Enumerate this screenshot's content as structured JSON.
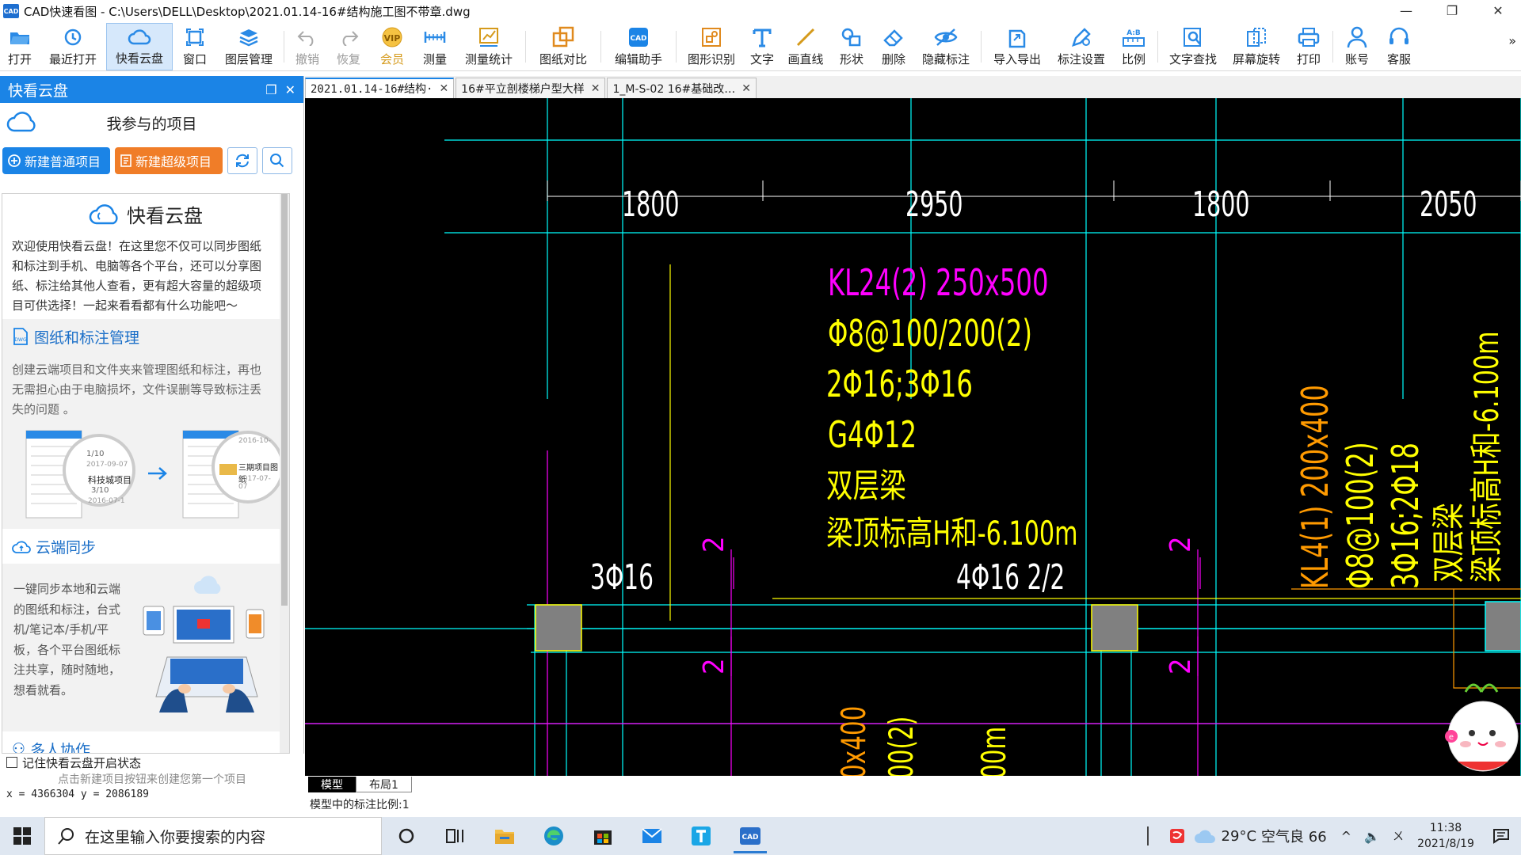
{
  "window": {
    "logo": "CAD",
    "title": "CAD快速看图 - C:\\Users\\DELL\\Desktop\\2021.01.14-16#结构施工图不带章.dwg",
    "minimize": "—",
    "maximize": "❐",
    "close": "✕"
  },
  "toolbar": {
    "open": "打开",
    "recent": "最近打开",
    "cloud": "快看云盘",
    "window": "窗口",
    "layers": "图层管理",
    "undo": "撤销",
    "redo": "恢复",
    "vip": "会员",
    "measure": "测量",
    "measure_stats": "测量统计",
    "compare": "图纸对比",
    "edit_helper": "编辑助手",
    "shape_recog": "图形识别",
    "text": "文字",
    "line": "画直线",
    "shape": "形状",
    "delete": "删除",
    "hide_annot": "隐藏标注",
    "import_export": "导入导出",
    "annot_settings": "标注设置",
    "scale": "比例",
    "text_search": "文字查找",
    "rotate": "屏幕旋转",
    "print": "打印",
    "account": "账号",
    "service": "客服",
    "more": "»"
  },
  "leftpanel": {
    "header": "快看云盘",
    "my_projects": "我参与的项目",
    "new_normal": "新建普通项目",
    "new_super": "新建超级项目",
    "intro_title": "快看云盘",
    "intro_text": "欢迎使用快看云盘！在这里您不仅可以同步图纸和标注到手机、电脑等各个平台，还可以分享图纸、标注给其他人查看，更有超大容量的超级项目可供选择！一起来看看都有什么功能吧～",
    "sec1_title": "图纸和标注管理",
    "sec1_text": "创建云端项目和文件夹来管理图纸和标注，再也无需担心由于电脑损坏，文件误删等导致标注丢失的问题 。",
    "sec1_img_a_label": "科技城项目",
    "sec1_img_a_count": "3/10",
    "sec1_img_a_date": "2016-07-1",
    "sec1_img_a_count2": "1/10",
    "sec1_img_a_date2": "2017-09-07",
    "sec1_img_b_label": "三期项目图纸",
    "sec1_img_b_date": "2017-07-07",
    "sec1_img_b_date2": "2016-10-",
    "sec2_title": "云端同步",
    "sec2_text": "一键同步本地和云端的图纸和标注，台式机/笔记本/手机/平板，各个平台图纸标注共享，随时随地，想看就看。",
    "sec3_title": "多人协作",
    "remember": "记住快看云盘开启状态",
    "hint": "点击新建项目按钮来创建您第一个项目",
    "coords": "x = 4366304 y = 2086189"
  },
  "tabs": [
    {
      "label": "2021.01.14-16#结构·",
      "close": "✕"
    },
    {
      "label": "16#平立剖楼梯户型大样",
      "close": "✕"
    },
    {
      "label": "1_M-S-02 16#基础改…",
      "close": "✕"
    }
  ],
  "cad": {
    "dim1": "1800",
    "dim2": "2950",
    "dim3": "1800",
    "dim4": "2050",
    "beam_label": "KL24(2) 250x500",
    "stirrup": "Φ8@100/200(2)",
    "bars": "2Φ16;3Φ16",
    "side_bars": "G4Φ12",
    "double_beam": "双层梁",
    "top_elev": "梁顶标高H和-6.100m",
    "rebar_left": "3Φ16",
    "rebar_mid": "4Φ16 2/2",
    "vert_kl4": "KL4(1) 200x400",
    "vert_stirrup": "Φ8@100(2)",
    "vert_bars": "3Φ16;2Φ18",
    "vert_double": "双层梁",
    "vert_elev": "梁顶标高H和-6.100m",
    "mark2": "2",
    "bottom_a": "0x400",
    "bottom_b": "00(2)",
    "bottom_c": "00m"
  },
  "layout_tabs": {
    "model": "模型",
    "layout1": "布局1"
  },
  "status": "模型中的标注比例:1",
  "taskbar": {
    "search_placeholder": "在这里输入你要搜索的内容",
    "temp": "29°C",
    "air": "空气良 66",
    "time": "11:38",
    "date": "2021/8/19",
    "cad_label": "CAD",
    "ime": "ㄨ"
  },
  "colors": {
    "accent": "#1b84e6",
    "orange": "#f07d28",
    "cad_yellow": "#ffff00",
    "cad_magenta": "#ff00ff",
    "cad_cyan": "#00ffff",
    "cad_orange": "#ff9a00"
  }
}
